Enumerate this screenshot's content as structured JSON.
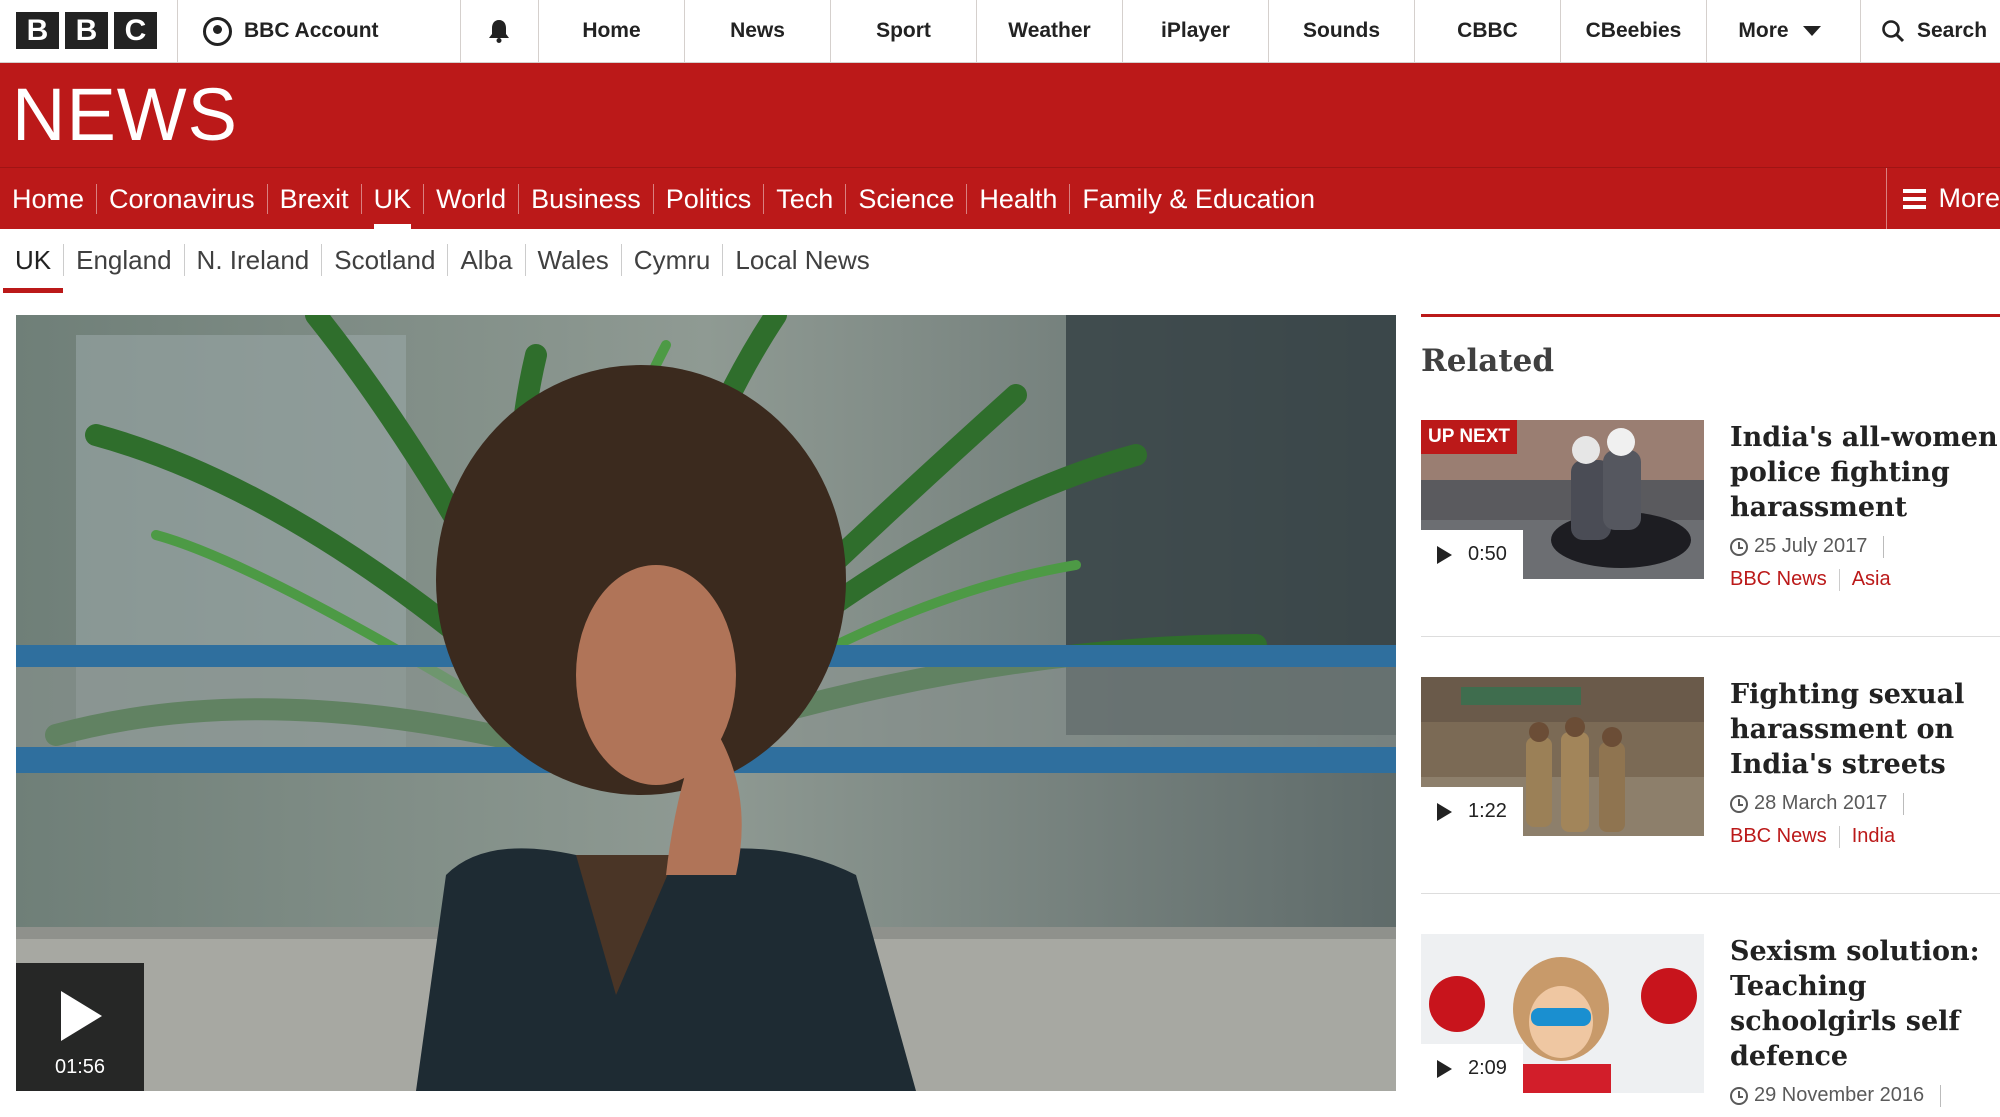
{
  "masthead": {
    "logo_letters": [
      "B",
      "B",
      "C"
    ],
    "account_label": "BBC Account",
    "nav": [
      "Home",
      "News",
      "Sport",
      "Weather",
      "iPlayer",
      "Sounds",
      "CBBC",
      "CBeebies"
    ],
    "more_label": "More",
    "search_label": "Search"
  },
  "news_band": {
    "title": "NEWS"
  },
  "section_nav": {
    "items": [
      "Home",
      "Coronavirus",
      "Brexit",
      "UK",
      "World",
      "Business",
      "Politics",
      "Tech",
      "Science",
      "Health",
      "Family & Education"
    ],
    "active": "UK",
    "more_label": "More"
  },
  "sub_nav": {
    "items": [
      "UK",
      "England",
      "N. Ireland",
      "Scotland",
      "Alba",
      "Wales",
      "Cymru",
      "Local News"
    ],
    "active": "UK"
  },
  "main_video": {
    "duration": "01:56"
  },
  "related": {
    "heading": "Related",
    "items": [
      {
        "badge": "UP NEXT",
        "duration": "0:50",
        "headline": "India's all-women police fighting harassment",
        "date": "25 July 2017",
        "source": "BBC News",
        "tag": "Asia"
      },
      {
        "badge": "",
        "duration": "1:22",
        "headline": "Fighting sexual harassment on India's streets",
        "date": "28 March 2017",
        "source": "BBC News",
        "tag": "India"
      },
      {
        "badge": "",
        "duration": "2:09",
        "headline": "Sexism solution: Teaching schoolgirls self defence",
        "date": "29 November 2016",
        "source": "",
        "tag": ""
      }
    ]
  },
  "colors": {
    "brand_red": "#bb1919",
    "text_dark": "#222222"
  }
}
